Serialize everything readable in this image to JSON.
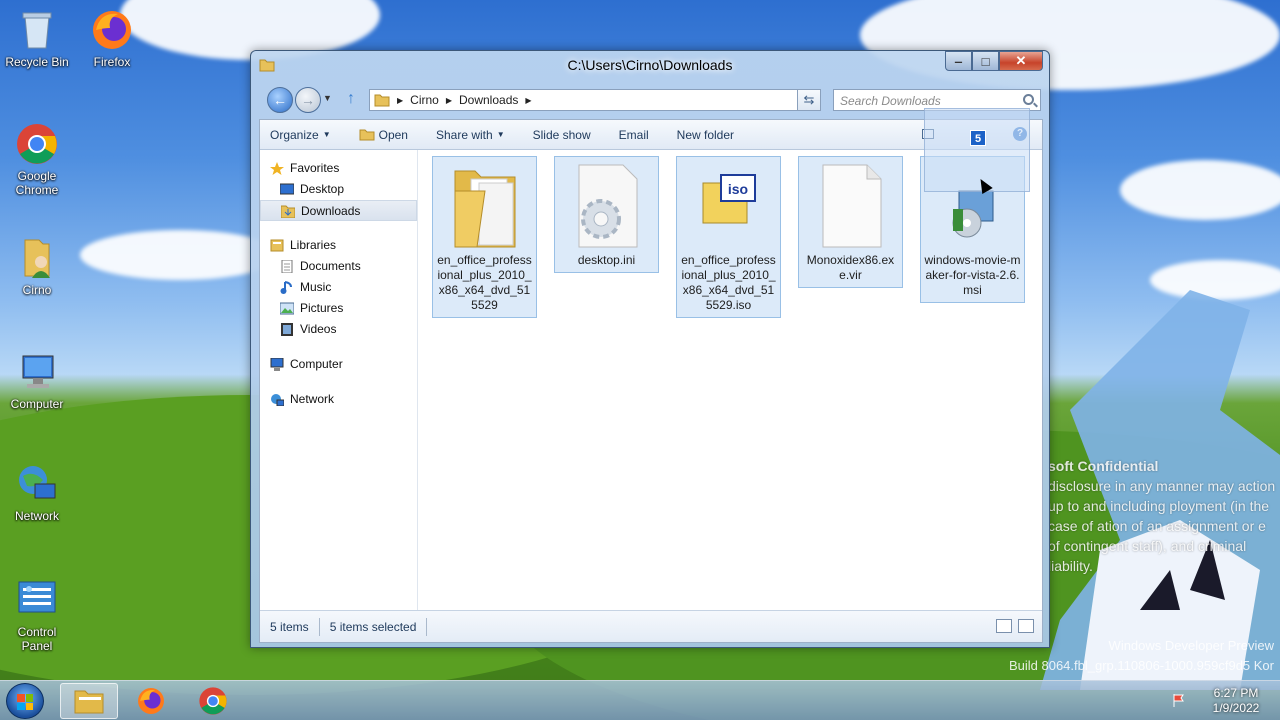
{
  "desktop": {
    "icons": [
      {
        "label": "Recycle Bin",
        "icon": "recycle-bin-icon"
      },
      {
        "label": "Firefox",
        "icon": "firefox-icon"
      },
      {
        "label": "Google Chrome",
        "icon": "chrome-icon"
      },
      {
        "label": "Cirno",
        "icon": "user-folder-icon"
      },
      {
        "label": "Computer",
        "icon": "computer-icon"
      },
      {
        "label": "Network",
        "icon": "network-icon"
      },
      {
        "label": "Control Panel",
        "icon": "control-panel-icon"
      }
    ],
    "watermark": {
      "title": "soft Confidential",
      "body": "disclosure in any manner may action up to and including ployment (in the case of ation of an assignment or e of contingent staff), and criminal liability."
    },
    "build_line1": "Windows Developer Preview",
    "build_line2": "Build 8064.fbl_grp.110806-1000.959cf9d5 Kor"
  },
  "window": {
    "title": "C:\\Users\\Cirno\\Downloads",
    "address": {
      "crumbs": [
        "Cirno",
        "Downloads"
      ]
    },
    "search_placeholder": "Search Downloads",
    "toolbar": {
      "organize": "Organize",
      "open": "Open",
      "share_with": "Share with",
      "slide_show": "Slide show",
      "email": "Email",
      "new_folder": "New folder"
    },
    "nav": {
      "favorites": "Favorites",
      "desktop": "Desktop",
      "downloads": "Downloads",
      "libraries": "Libraries",
      "documents": "Documents",
      "music": "Music",
      "pictures": "Pictures",
      "videos": "Videos",
      "computer": "Computer",
      "network": "Network"
    },
    "files": [
      {
        "name": "en_office_professional_plus_2010_x86_x64_dvd_515529",
        "icon": "folder-icon"
      },
      {
        "name": "desktop.ini",
        "icon": "settings-file-icon"
      },
      {
        "name": "en_office_professional_plus_2010_x86_x64_dvd_515529.iso",
        "icon": "iso-file-icon"
      },
      {
        "name": "Monoxidex86.exe.vir",
        "icon": "blank-file-icon"
      },
      {
        "name": "windows-movie-maker-for-vista-2.6.msi",
        "icon": "installer-icon"
      }
    ],
    "status": {
      "count": "5 items",
      "selected": "5 items selected"
    },
    "drag_count": "5"
  },
  "taskbar": {
    "time": "6:27 PM",
    "date": "1/9/2022"
  },
  "colors": {
    "accent": "#2a6cc7",
    "selection": "#dceaf9",
    "close": "#c7432a"
  }
}
